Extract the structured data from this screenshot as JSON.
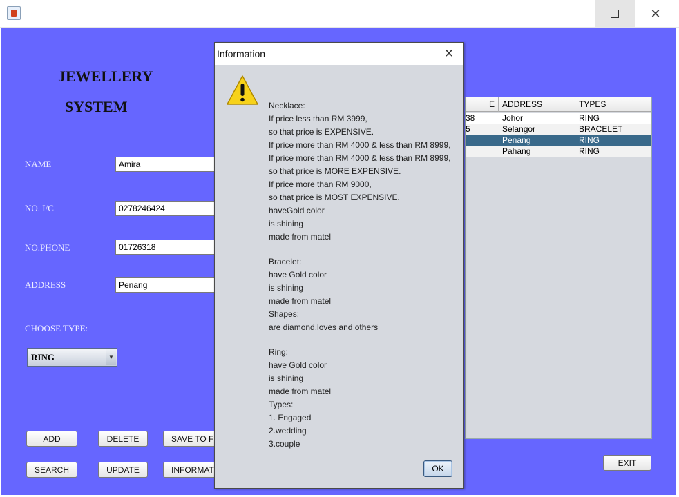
{
  "window": {
    "close_glyph": "✕"
  },
  "app": {
    "title_line1": "JEWELLERY",
    "title_line2": "SYSTEM"
  },
  "form": {
    "name_label": "NAME",
    "name_value": "Amira",
    "ic_label": "NO. I/C",
    "ic_value": "0278246424",
    "phone_label": "NO.PHONE",
    "phone_value": "01726318",
    "address_label": "ADDRESS",
    "address_value": "Penang",
    "type_label": "CHOOSE TYPE:",
    "type_selected": "RING"
  },
  "buttons": {
    "add": "ADD",
    "delete": "DELETE",
    "save": "SAVE TO FI",
    "search": "SEARCH",
    "update": "UPDATE",
    "information": "INFORMATI",
    "exit": "EXIT"
  },
  "table": {
    "headers": [
      "E",
      "ADDRESS",
      "TYPES"
    ],
    "rows": [
      {
        "phone": "38",
        "address": "Johor",
        "type": "RING"
      },
      {
        "phone": "5",
        "address": "Selangor",
        "type": "BRACELET"
      },
      {
        "phone": "",
        "address": "Penang",
        "type": "RING"
      },
      {
        "phone": "",
        "address": "Pahang",
        "type": "RING"
      }
    ]
  },
  "dialog": {
    "title": "Information",
    "close_glyph": "✕",
    "ok_label": "OK",
    "lines": [
      "Necklace:",
      "If price less than RM 3999,",
      "so that price is EXPENSIVE.",
      "If price more than RM 4000 & less than RM 8999,",
      "If price more than RM 4000 & less than RM 8999,",
      "so that price is MORE EXPENSIVE.",
      "If price more than RM 9000,",
      "so that price is MOST EXPENSIVE.",
      "haveGold color",
      "is shining",
      "made from matel",
      "",
      "Bracelet:",
      "have Gold color",
      "is shining",
      "made from matel",
      "Shapes:",
      "are diamond,loves and others",
      "",
      "Ring:",
      "have Gold color",
      "is shining",
      "made from matel",
      "Types:",
      "1. Engaged",
      "2.wedding",
      "3.couple"
    ]
  },
  "colors": {
    "client_bg": "#6666ff",
    "selected_row": "#39698a",
    "dialog_bg": "#d6d9df"
  }
}
